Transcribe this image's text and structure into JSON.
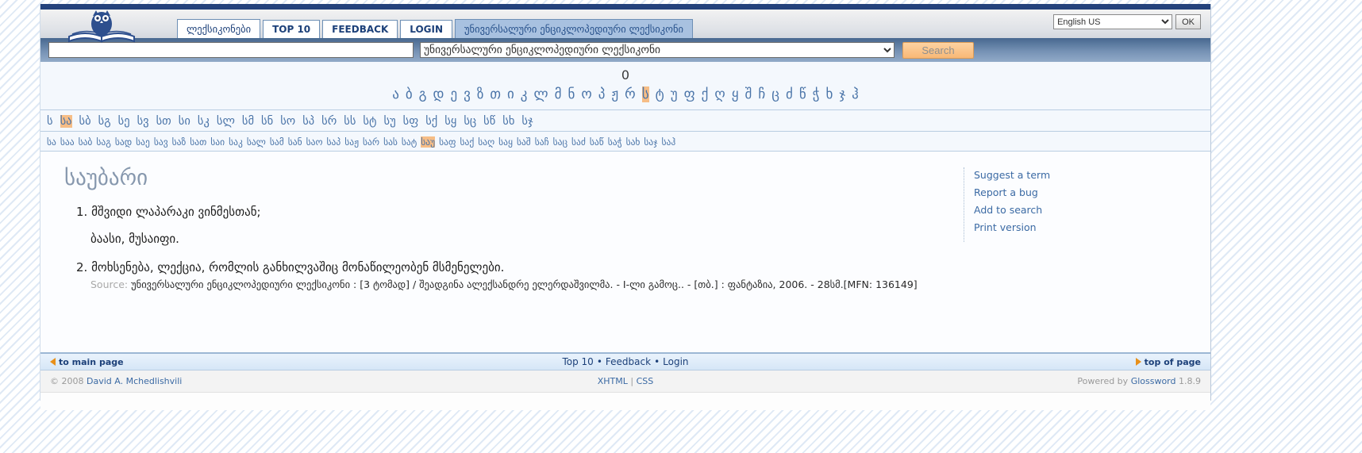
{
  "header": {
    "logo_label": "owl-book-logo",
    "tabs": [
      {
        "label": "ლექსიკონები"
      },
      {
        "label": "TOP 10"
      },
      {
        "label": "FEEDBACK"
      },
      {
        "label": "LOGIN"
      },
      {
        "label": "უნივერსალური ენციკლოპედიური ლექსიკონი"
      }
    ],
    "language": {
      "selected": "English US",
      "ok_label": "OK"
    }
  },
  "search": {
    "input_value": "",
    "dictionary_selected": "უნივერსალური ენციკლოპედიური ლექსიკონი",
    "button_label": "Search"
  },
  "nav": {
    "result_count": "0",
    "alphabet": [
      "ა",
      "ბ",
      "გ",
      "დ",
      "ე",
      "ვ",
      "ზ",
      "თ",
      "ი",
      "კ",
      "ლ",
      "მ",
      "ნ",
      "ო",
      "პ",
      "ჟ",
      "რ",
      "ს",
      "ტ",
      "უ",
      "ფ",
      "ქ",
      "ღ",
      "ყ",
      "შ",
      "ჩ",
      "ც",
      "ძ",
      "წ",
      "ჭ",
      "ხ",
      "ჯ",
      "ჰ"
    ],
    "alphabet_active": "ს",
    "prefixes2": [
      "ს",
      "სა",
      "სბ",
      "სგ",
      "სე",
      "სვ",
      "სთ",
      "სი",
      "სკ",
      "სლ",
      "სმ",
      "სნ",
      "სო",
      "სპ",
      "სრ",
      "სს",
      "სტ",
      "სუ",
      "სფ",
      "სქ",
      "სყ",
      "სც",
      "სწ",
      "სხ",
      "სჯ"
    ],
    "prefixes2_active": "სა",
    "prefixes3": [
      "სა",
      "საა",
      "საბ",
      "საგ",
      "სად",
      "საე",
      "სავ",
      "საზ",
      "სათ",
      "საი",
      "საკ",
      "სალ",
      "სამ",
      "სან",
      "საო",
      "საპ",
      "საჟ",
      "სარ",
      "სას",
      "სატ",
      "საუ",
      "საფ",
      "საქ",
      "საღ",
      "საყ",
      "საშ",
      "საჩ",
      "საც",
      "საძ",
      "საწ",
      "საჭ",
      "სახ",
      "საჯ",
      "საჰ"
    ],
    "prefixes3_active": "საუ"
  },
  "entry": {
    "headword": "საუბარი",
    "sense1_number": "1.",
    "sense1_line1": "მშვიდი ლაპარაკი ვინმესთან;",
    "sense1_line2": "ბაასი, მუსაიფი.",
    "sense2_number": "2.",
    "sense2_line1": "მოხსენება, ლექცია, რომლის განხილვაშიც მონაწილეობენ მსმენელები.",
    "source_label": "Source:",
    "source_text": "უნივერსალური ენციკლოპედიური ლექსიკონი : [3 ტომად] / შეადგინა ალექსანდრე ელერდაშვილმა. - I-ლი გამოც.. - [თბ.] : ფანტაზია, 2006. - 28სმ.[MFN: 136149]"
  },
  "sidebar": {
    "links": [
      "Suggest a term",
      "Report a bug",
      "Add to search",
      "Print version"
    ]
  },
  "footer": {
    "to_main_page": "to main page",
    "top10": "Top 10",
    "feedback": "Feedback",
    "login": "Login",
    "separator": "•",
    "top_of_page": "top of page",
    "copyright_prefix": "© 2008",
    "copyright_link": "David A. Mchedlishvili",
    "xhtml": "XHTML",
    "pipe": "|",
    "css": "CSS",
    "powered_prefix": "Powered by",
    "powered_link": "Glossword",
    "powered_version": "1.8.9"
  }
}
